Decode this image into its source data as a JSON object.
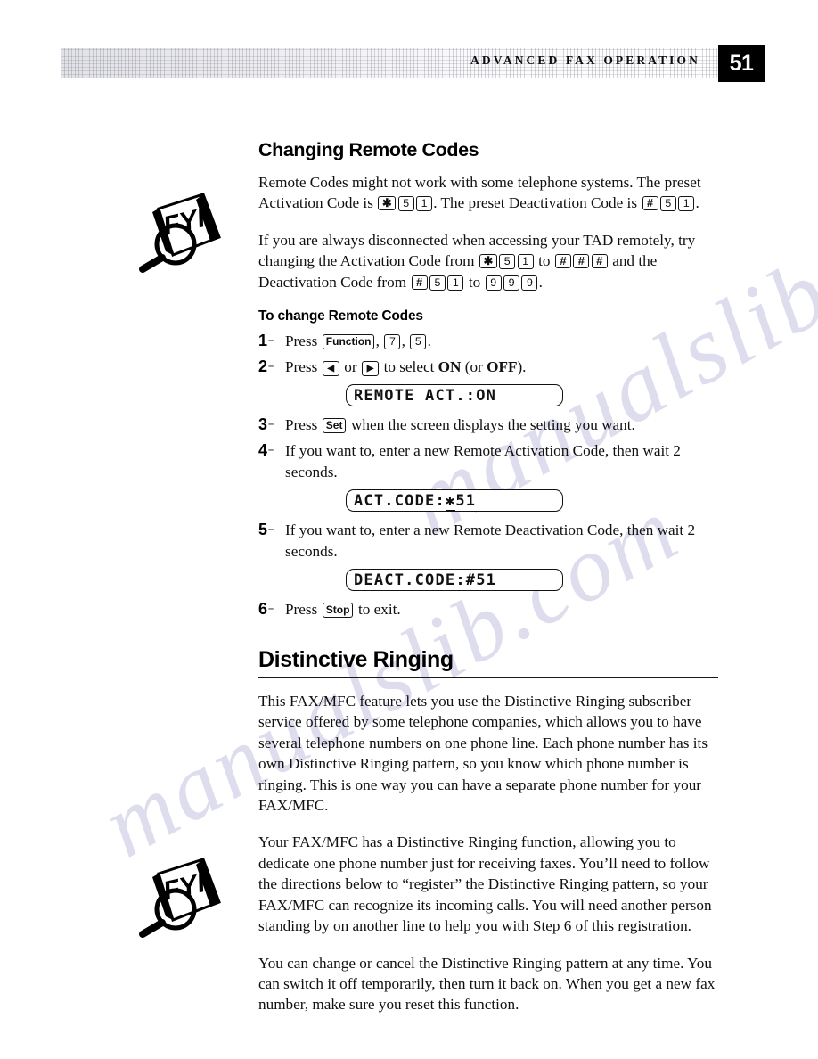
{
  "header": {
    "title": "ADVANCED FAX OPERATION",
    "page_number": "51"
  },
  "watermark": {
    "line1": "manualslib.com",
    "line2": "manualslib.com"
  },
  "icons": {
    "fyi_label": "FYI"
  },
  "sections": [
    {
      "heading": "Changing Remote Codes",
      "paragraph1_a": "Remote Codes might not work with some telephone systems. The preset Activation Code is ",
      "paragraph1_b": ". The preset Deactivation Code is ",
      "paragraph1_c": ".",
      "paragraph2_a": "If you are always disconnected when accessing your TAD remotely, try changing the Activation Code from ",
      "paragraph2_b": " to ",
      "paragraph2_c": " and the Deactivation Code from ",
      "paragraph2_d": " to ",
      "paragraph2_e": "."
    }
  ],
  "keys": {
    "star": "✱",
    "hash": "#",
    "one": "1",
    "five": "5",
    "seven": "7",
    "nine": "9",
    "function": "Function",
    "set": "Set",
    "stop": "Stop",
    "left_arrow": "◀",
    "right_arrow": "▶"
  },
  "procedure": {
    "title": "To change Remote Codes",
    "steps": [
      {
        "num": "1",
        "text_a": "Press ",
        "text_b": ", ",
        "text_c": ", ",
        "text_d": "."
      },
      {
        "num": "2",
        "text_a": "Press ",
        "text_b": " or ",
        "text_c": " to select ",
        "on": "ON",
        "text_d": " (or ",
        "off": "OFF",
        "text_e": ")."
      },
      {
        "num": "3",
        "text_a": "Press ",
        "text_b": " when the screen displays the setting you want."
      },
      {
        "num": "4",
        "text_a": "If you want to, enter a new Remote Activation Code, then wait 2 seconds."
      },
      {
        "num": "5",
        "text_a": "If you want to, enter a new Remote Deactivation Code, then wait 2 seconds."
      },
      {
        "num": "6",
        "text_a": "Press ",
        "text_b": " to exit."
      }
    ]
  },
  "lcd_displays": {
    "remote_act": "REMOTE ACT.:ON",
    "act_code_prefix": "ACT.CODE:",
    "act_code_cursor": "✱",
    "act_code_suffix": "51",
    "deact_code": "DEACT.CODE:#51"
  },
  "distinctive_ringing": {
    "heading": "Distinctive Ringing",
    "paragraph1": "This FAX/MFC feature lets you use the Distinctive Ringing subscriber service offered by some telephone companies, which allows you to have several telephone numbers on one phone line. Each phone number has its own Distinctive Ringing pattern, so you know which phone number is ringing. This is one way you can have a separate phone number for your  FAX/MFC.",
    "paragraph2": "Your FAX/MFC has a Distinctive Ringing function, allowing you to dedicate one phone number just for receiving faxes. You’ll need to follow the directions below to “register” the Distinctive Ringing pattern, so your FAX/MFC can recognize its incoming calls. You will need another person standing by on another line to help you with Step 6 of this registration.",
    "paragraph3": "You can change or cancel the Distinctive Ringing pattern at any time. You can switch it off temporarily, then turn it back on. When you get a new fax number, make sure you reset this function."
  },
  "colors": {
    "page_number_box": "#000000",
    "page_number_text": "#ffffff",
    "text": "#101010",
    "watermark": "#c9c9e4"
  }
}
